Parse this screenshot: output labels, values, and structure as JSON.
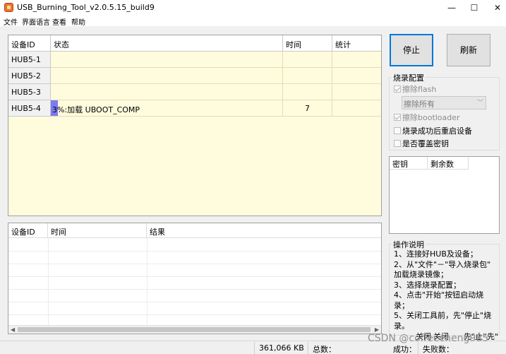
{
  "window": {
    "title": "USB_Burning_Tool_v2.0.5.15_build9",
    "controls": {
      "minimize": "—",
      "maximize": "☐",
      "close": "✕"
    }
  },
  "menu": [
    "文件",
    "界面语言",
    "查看",
    "帮助"
  ],
  "device_table": {
    "columns": [
      "设备ID",
      "状态",
      "时间",
      "统计"
    ],
    "rows": [
      {
        "id": "HUB5-1",
        "status": "",
        "time": "",
        "stats": ""
      },
      {
        "id": "HUB5-2",
        "status": "",
        "time": "",
        "stats": ""
      },
      {
        "id": "HUB5-3",
        "status": "",
        "time": "",
        "stats": ""
      },
      {
        "id": "HUB5-4",
        "status": "3%:加载 UBOOT_COMP",
        "time": "7",
        "stats": "",
        "progress_percent": 3
      }
    ]
  },
  "log_table": {
    "columns": [
      "设备ID",
      "时间",
      "结果"
    ]
  },
  "buttons": {
    "stop": "停止",
    "refresh": "刷新"
  },
  "burn_config": {
    "title": "烧录配置",
    "erase_flash": "擦除flash",
    "erase_mode": "擦除所有",
    "erase_bootloader": "擦除bootloader",
    "reset_after_success": "烧录成功后重启设备",
    "overwrite_key": "是否覆盖密钥"
  },
  "key_table": {
    "columns": [
      "密钥",
      "剩余数"
    ]
  },
  "instructions": {
    "title": "操作说明",
    "lines": [
      "1、连接好HUB及设备；",
      "2、从\"文件\"－\"导入烧录包\"",
      "加载烧录镜像；",
      "3、选择烧录配置；",
      "4、点击\"开始\"按钮启动烧",
      "录；",
      "5、关闭工具前，先\"停止\"烧",
      "录。"
    ],
    "truncated": [
      "关闭",
      "关闭",
      "先\"止\"",
      "先\""
    ]
  },
  "statusbar": {
    "size": "361,066 KB",
    "total_label": "总数：",
    "success_label": "成功：",
    "fail_label": "失败数："
  },
  "watermark": "CSDN @coffeecheng985"
}
